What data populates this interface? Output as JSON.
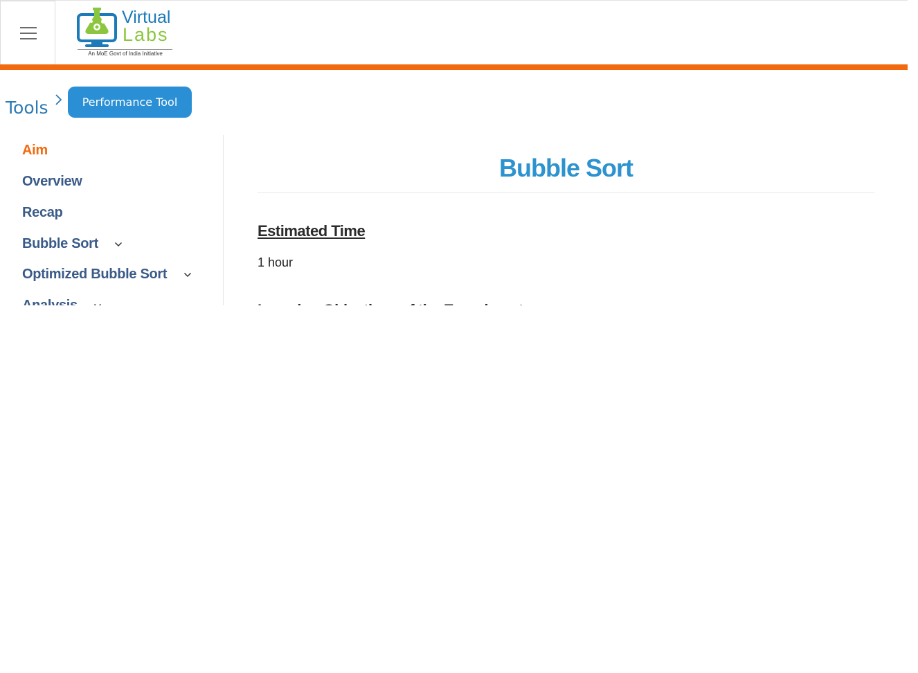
{
  "header": {
    "logo": {
      "text_virtual": "Virtual",
      "text_labs": "Labs",
      "tagline": "An MoE Govt of India Initiative"
    },
    "accent_color": "#f26a0f"
  },
  "breadcrumb": {
    "tools_label": "Tools",
    "performance_tool_label": "Performance Tool"
  },
  "sidebar": {
    "items": [
      {
        "label": "Aim",
        "active": true,
        "expandable": false
      },
      {
        "label": "Overview",
        "active": false,
        "expandable": false
      },
      {
        "label": "Recap",
        "active": false,
        "expandable": false
      },
      {
        "label": "Bubble Sort",
        "active": false,
        "expandable": true
      },
      {
        "label": "Optimized Bubble Sort",
        "active": false,
        "expandable": true
      },
      {
        "label": "Analysis",
        "active": false,
        "expandable": true
      }
    ]
  },
  "main": {
    "title": "Bubble Sort",
    "estimated_time_heading": "Estimated Time",
    "estimated_time_value": "1 hour",
    "learning_objectives_heading": "Learning Objectives of the Experiment"
  },
  "colors": {
    "title": "#2d93cf",
    "sidebar_text": "#3a5a88",
    "sidebar_active": "#f26a0f",
    "button_bg": "#2a8fd4"
  }
}
